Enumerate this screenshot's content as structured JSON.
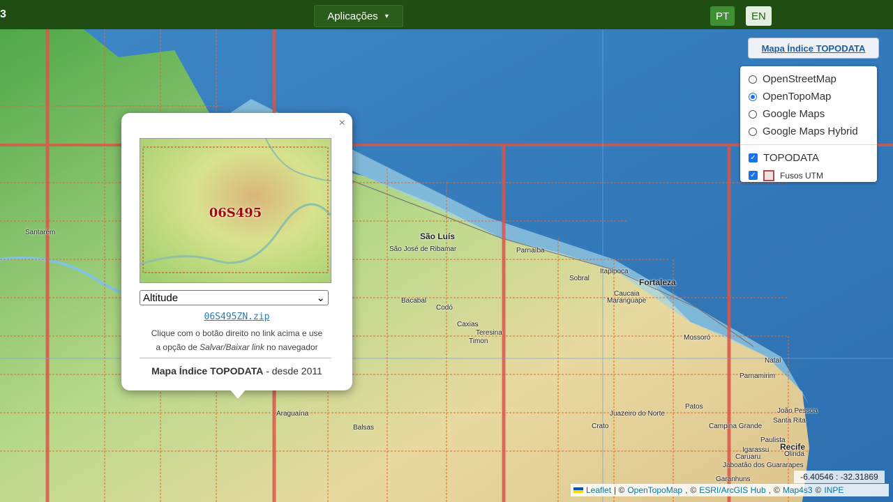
{
  "topbar": {
    "brand": "3",
    "apps_label": "Aplicações",
    "lang_pt": "PT",
    "lang_en": "EN"
  },
  "index_button": "Mapa Índice TOPODATA",
  "layers": {
    "base": [
      {
        "label": "OpenStreetMap",
        "selected": false
      },
      {
        "label": "OpenTopoMap",
        "selected": true
      },
      {
        "label": "Google Maps",
        "selected": false
      },
      {
        "label": "Google Maps Hybrid",
        "selected": false
      }
    ],
    "overlays": [
      {
        "label": "TOPODATA",
        "checked": true
      },
      {
        "label": "Fusos UTM",
        "checked": true
      }
    ]
  },
  "popup": {
    "tile_code": "06S495",
    "select_value": "Altitude",
    "zip_link": "06S495ZN.zip",
    "hint_1": "Clique com o botão direito no link acima e use",
    "hint_2_prefix": "a opção de ",
    "hint_2_italic": "Salvar/Baixar link",
    "hint_2_suffix": " no navegador",
    "footer_bold": "Mapa Índice TOPODATA",
    "footer_rest": " - desde 2011",
    "close": "×"
  },
  "places": [
    "Santarém",
    "São Luís",
    "São José de Ribamar",
    "Parnaíba",
    "Bacabal",
    "Codó",
    "Caxias",
    "Teresina",
    "Timon",
    "Sobral",
    "Itapipoca",
    "Fortaleza",
    "Caucaia",
    "Maranguape",
    "Mossoró",
    "Natal",
    "Parnamirim",
    "Juazeiro do Norte",
    "Crato",
    "Patos",
    "Campina Grande",
    "João Pessoa",
    "Santa Rita",
    "Paulista",
    "Recife",
    "Olinda",
    "Igarassu",
    "Caruaru",
    "Jaboatão dos Guararapes",
    "Garanhuns",
    "Araguaína",
    "Balsas"
  ],
  "coords": "-6.40546 : -32.31869",
  "attribution": {
    "leaflet": "Leaflet",
    "sep": "| ©",
    "otm": "OpenTopoMap",
    "esri": "ESRI/ArcGIS Hub",
    "map4s3": "Map4s3",
    "inpe": "INPE"
  }
}
